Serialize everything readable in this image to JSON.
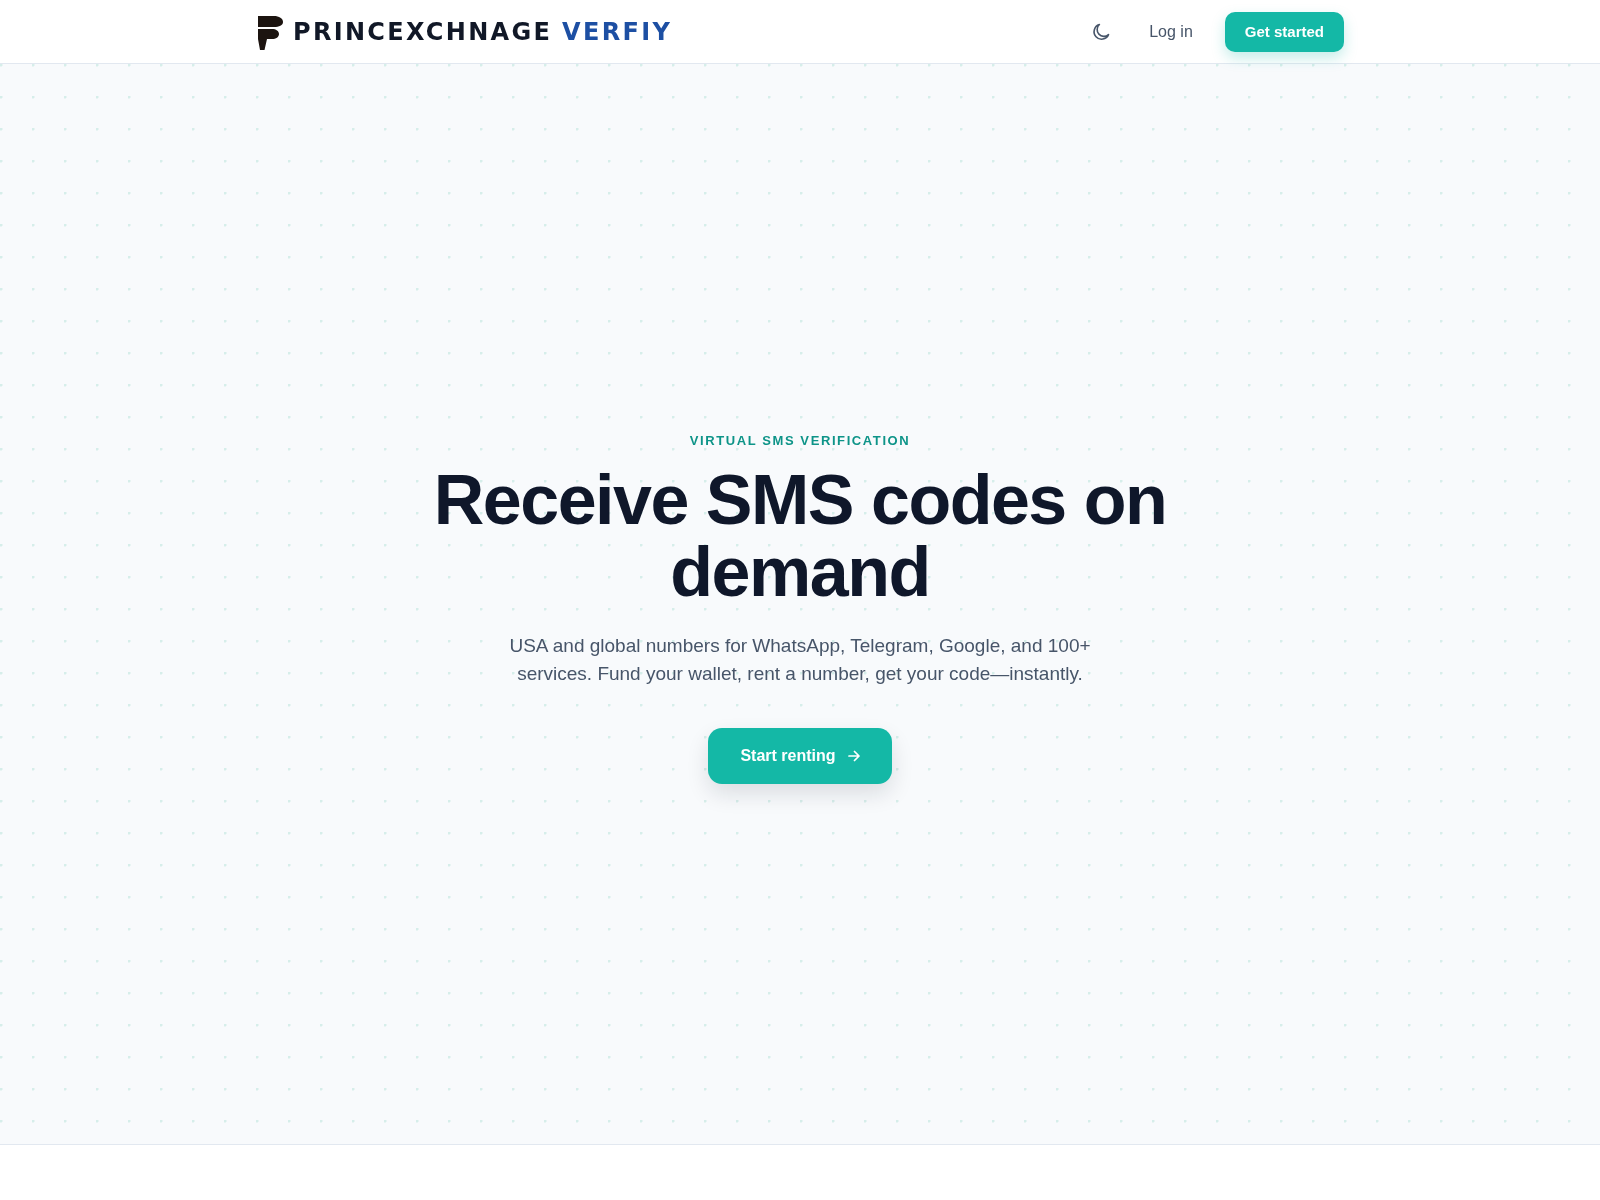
{
  "header": {
    "logo": {
      "name": "PRINCEXCHNAGE",
      "suffix": "VERFIY"
    },
    "login": {
      "label": "Log in"
    },
    "cta": {
      "label": "Get started"
    }
  },
  "hero": {
    "eyebrow": "VIRTUAL SMS VERIFICATION",
    "title": "Receive SMS codes on demand",
    "subtitle": "USA and global numbers for WhatsApp, Telegram, Google, and 100+ services. Fund your wallet, rent a number, get your code—instantly.",
    "button": {
      "label": "Start renting"
    }
  }
}
